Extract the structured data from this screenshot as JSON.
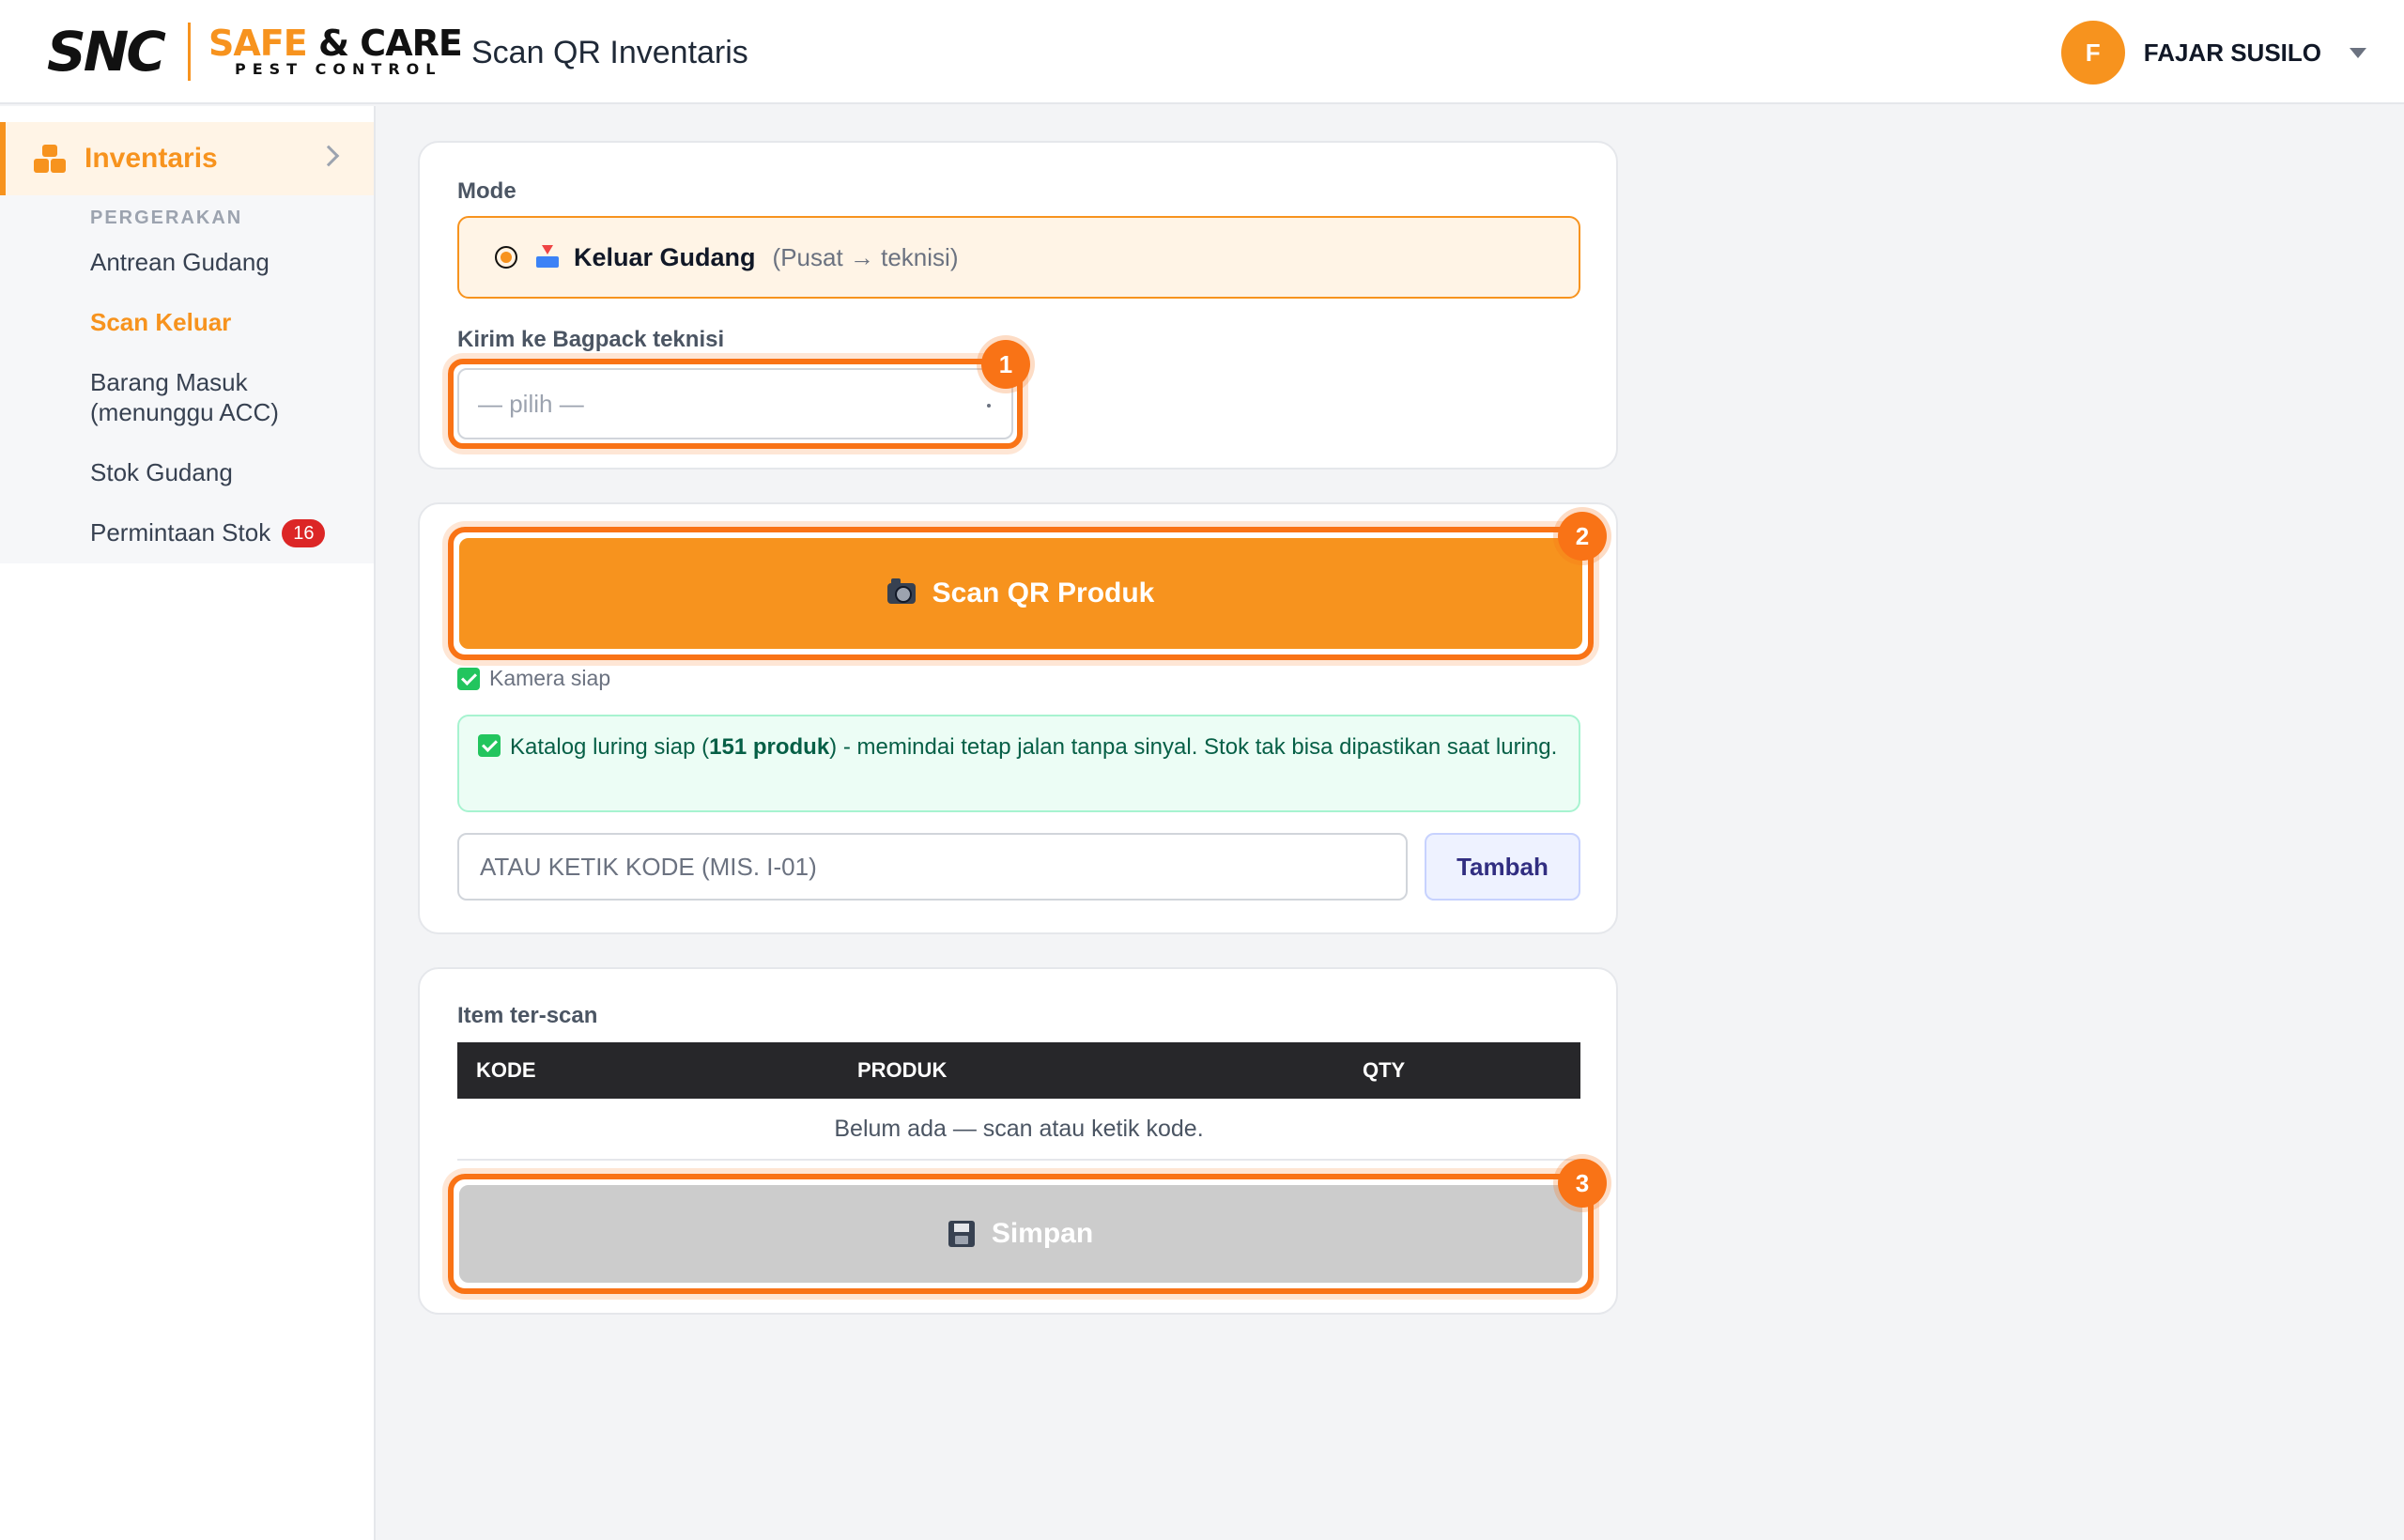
{
  "header": {
    "logo_brand": "SNC",
    "logo_safe": "SAFE",
    "logo_care": "& CARE",
    "logo_pest": "PEST CONTROL",
    "title": "Scan QR Inventaris",
    "user": {
      "initial": "F",
      "name": "FAJAR SUSILO"
    }
  },
  "sidebar": {
    "active_group": "Inventaris",
    "section_label": "PERGERAKAN",
    "items": [
      {
        "label": "Antrean Gudang",
        "active": false
      },
      {
        "label": "Scan Keluar",
        "active": true
      },
      {
        "label": "Barang Masuk (menunggu ACC)",
        "active": false
      },
      {
        "label": "Stok Gudang",
        "active": false
      },
      {
        "label": "Permintaan Stok",
        "active": false,
        "badge": "16"
      }
    ]
  },
  "mode_card": {
    "mode_label": "Mode",
    "mode_main": "Keluar Gudang",
    "mode_sub": "(Pusat → teknisi)",
    "target_label": "Kirim ke Bagpack teknisi",
    "target_placeholder": "— pilih —"
  },
  "scan_card": {
    "scan_button": "Scan QR Produk",
    "camera_status": "Kamera siap",
    "offline_prefix": "Katalog luring siap (",
    "offline_count": "151 produk",
    "offline_suffix": ") - memindai tetap jalan tanpa sinyal. Stok tak bisa dipastikan saat luring.",
    "code_placeholder": "ATAU KETIK KODE (MIS. I-01)",
    "add_button": "Tambah"
  },
  "items_card": {
    "title": "Item ter-scan",
    "columns": [
      "KODE",
      "PRODUK",
      "QTY"
    ],
    "empty_text": "Belum ada — scan atau ketik kode.",
    "save_button": "Simpan"
  },
  "markers": [
    "1",
    "2",
    "3"
  ],
  "colors": {
    "brand_orange": "#f7931e",
    "highlight_orange": "#f97316",
    "success_green": "#22c55e",
    "badge_red": "#dc2626",
    "table_header": "#27272a"
  }
}
